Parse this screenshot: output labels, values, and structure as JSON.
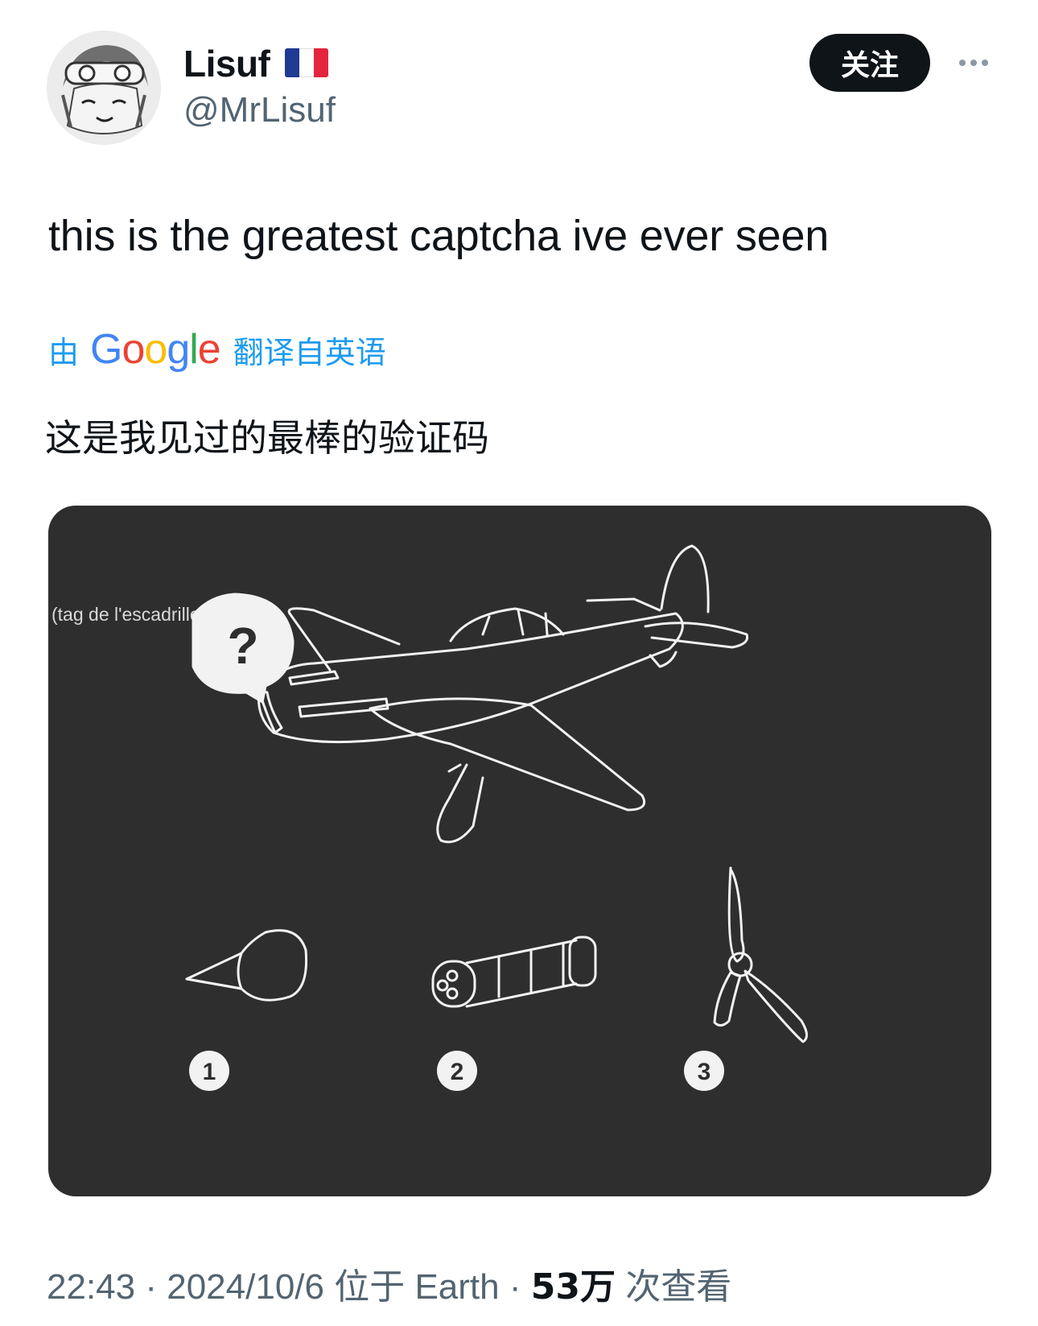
{
  "author": {
    "display_name": "Lisuf",
    "handle": "@MrLisuf",
    "flag_colors": [
      "#1f3a93",
      "#ffffff",
      "#e4253d"
    ]
  },
  "follow_button": {
    "label": "关注"
  },
  "more_button": {
    "icon": "more-horizontal-icon"
  },
  "tweet": {
    "text": "this is the greatest captcha ive ever seen"
  },
  "translation": {
    "prefix": "由",
    "brand": "Google",
    "suffix": "翻译自英语",
    "text": "这是我见过的最棒的验证码",
    "accent": "#1d9bf0"
  },
  "media": {
    "caption": "(tag de l'escadrille inclus).",
    "question_mark": "?",
    "options": [
      {
        "number": "1",
        "icon": "engine-cowling-icon"
      },
      {
        "number": "2",
        "icon": "gatling-gun-icon"
      },
      {
        "number": "3",
        "icon": "propeller-icon"
      }
    ],
    "background": "#2e2e2e"
  },
  "meta": {
    "time": "22:43",
    "date": "2024/10/6",
    "location_prefix": "位于",
    "location": "Earth",
    "views_count": "53万",
    "views_label": "次查看",
    "separator": "·"
  }
}
